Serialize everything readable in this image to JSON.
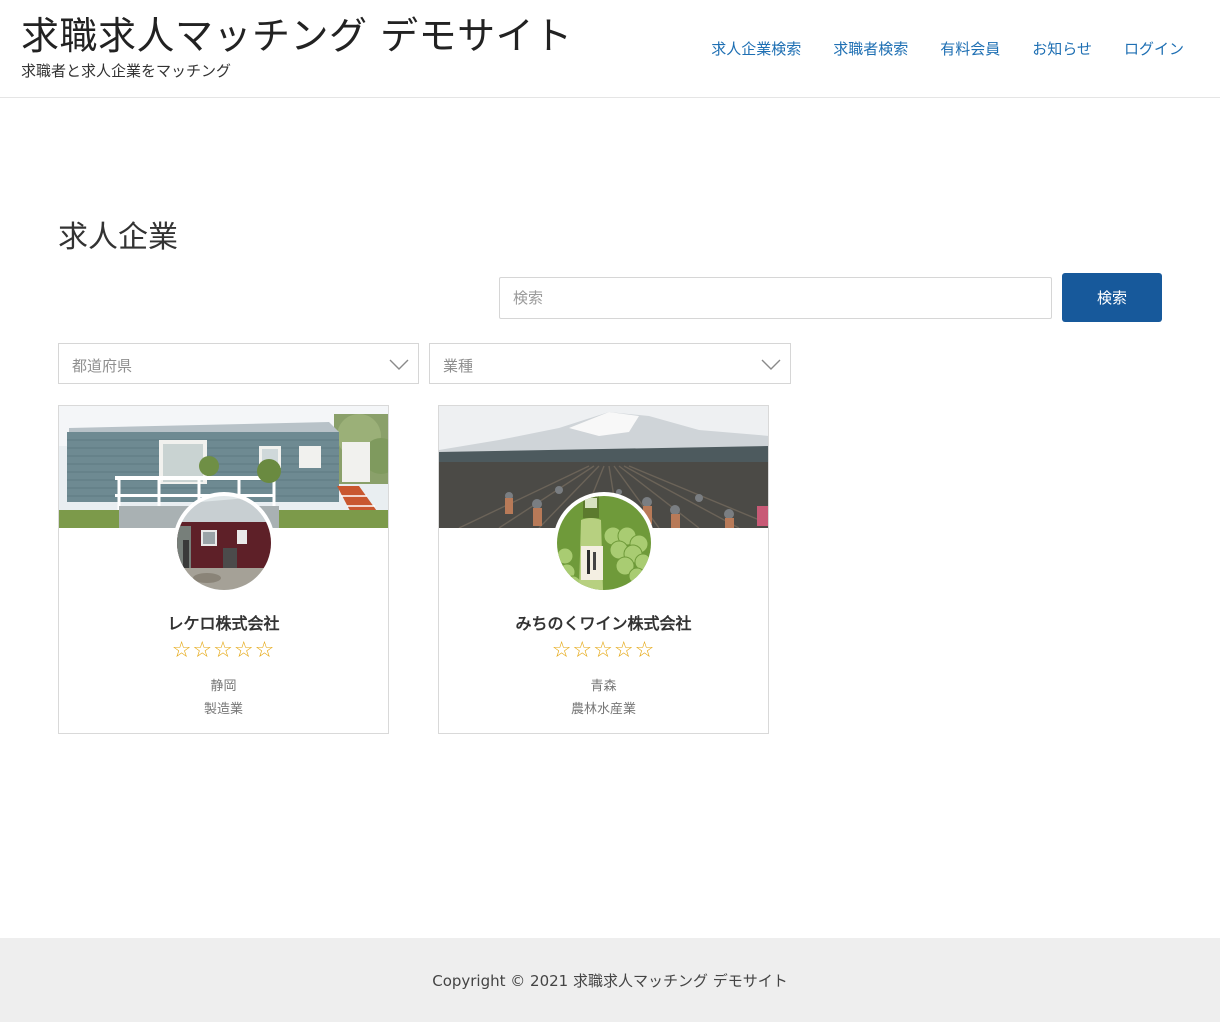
{
  "header": {
    "site_title": "求職求人マッチング デモサイト",
    "tagline": "求職者と求人企業をマッチング",
    "nav": [
      {
        "label": "求人企業検索"
      },
      {
        "label": "求職者検索"
      },
      {
        "label": "有料会員"
      },
      {
        "label": "お知らせ"
      },
      {
        "label": "ログイン"
      }
    ]
  },
  "main": {
    "heading": "求人企業",
    "search": {
      "placeholder": "検索",
      "button_label": "検索"
    },
    "filters": {
      "prefecture": "都道府県",
      "industry": "業種"
    },
    "companies": [
      {
        "name": "レケロ株式会社",
        "stars": "☆☆☆☆☆",
        "location": "静岡",
        "industry": "製造業"
      },
      {
        "name": "みちのくワイン株式会社",
        "stars": "☆☆☆☆☆",
        "location": "青森",
        "industry": "農林水産業"
      }
    ]
  },
  "footer": {
    "copyright": "Copyright © 2021 求職求人マッチング デモサイト"
  },
  "colors": {
    "accent": "#17599b",
    "link": "#1e6fb3",
    "star": "#e5a814",
    "footer_bg": "#eeeeee"
  },
  "icons": {
    "select_arrow": "chevron-down-icon",
    "rating": "star-outline-icon"
  }
}
